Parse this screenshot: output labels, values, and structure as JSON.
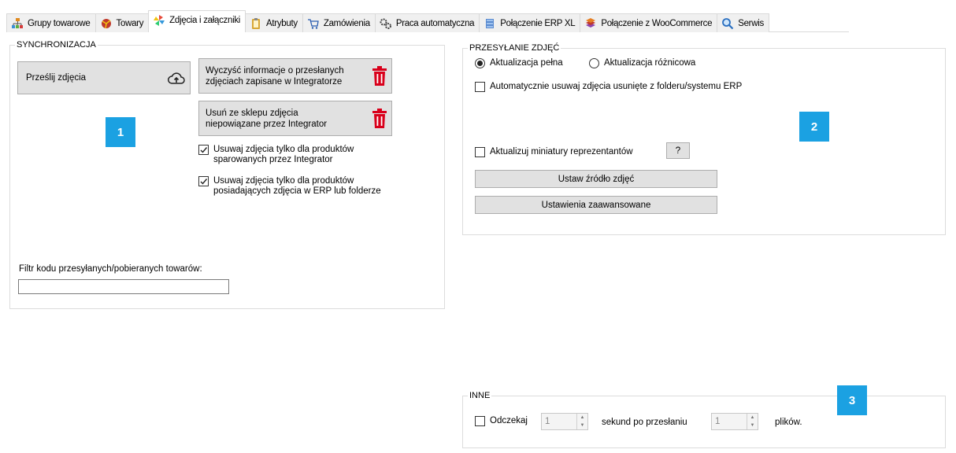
{
  "tabs": [
    {
      "label": "Grupy towarowe",
      "icon": "hierarchy-icon"
    },
    {
      "label": "Towary",
      "icon": "ball-icon"
    },
    {
      "label": "Zdjęcia i załączniki",
      "icon": "pinwheel-icon"
    },
    {
      "label": "Atrybuty",
      "icon": "clipboard-icon"
    },
    {
      "label": "Zamówienia",
      "icon": "cart-icon"
    },
    {
      "label": "Praca automatyczna",
      "icon": "gears-icon"
    },
    {
      "label": "Połączenie ERP XL",
      "icon": "database-icon"
    },
    {
      "label": "Połączenie z WooCommerce",
      "icon": "woo-icon"
    },
    {
      "label": "Serwis",
      "icon": "magnifier-icon"
    }
  ],
  "active_tab": "Zdjęcia i załączniki",
  "sync": {
    "title": "SYNCHRONIZACJA",
    "upload_button": "Prześlij zdjęcia",
    "clear_button_line1": "Wyczyść informacje o przesłanych",
    "clear_button_line2": "zdjęciach zapisane w Integratorze",
    "remove_button_line1": "Usuń ze sklepu zdjęcia",
    "remove_button_line2": "niepowiązane przez Integrator",
    "check1_line1": "Usuwaj zdjęcia tylko dla produktów",
    "check1_line2": "sparowanych przez Integrator",
    "check1_checked": true,
    "check2_line1": "Usuwaj zdjęcia tylko dla produktów",
    "check2_line2": "posiadających zdjęcia w ERP lub folderze",
    "check2_checked": true,
    "filter_label": "Filtr kodu przesyłanych/pobieranych towarów:",
    "filter_value": ""
  },
  "upload": {
    "title": "PRZESYŁANIE ZDJĘĆ",
    "radio_full": "Aktualizacja pełna",
    "radio_diff": "Aktualizacja różnicowa",
    "selected_mode": "Aktualizacja pełna",
    "auto_remove": "Automatycznie usuwaj zdjęcia usunięte z folderu/systemu ERP",
    "auto_remove_checked": false,
    "thumbs": "Aktualizuj miniatury reprezentantów",
    "thumbs_checked": false,
    "help_button": "?",
    "source_button": "Ustaw źródło zdjęć",
    "advanced_button": "Ustawienia zaawansowane"
  },
  "other": {
    "title": "INNE",
    "wait_label": "Odczekaj",
    "wait_checked": false,
    "seconds_value": "1",
    "seconds_label": "sekund po przesłaniu",
    "files_value": "1",
    "files_label": "plików."
  },
  "badges": [
    "1",
    "2",
    "3"
  ],
  "colors": {
    "badge": "#1ba1e2",
    "trash": "#d9001b",
    "button": "#e1e1e1"
  }
}
